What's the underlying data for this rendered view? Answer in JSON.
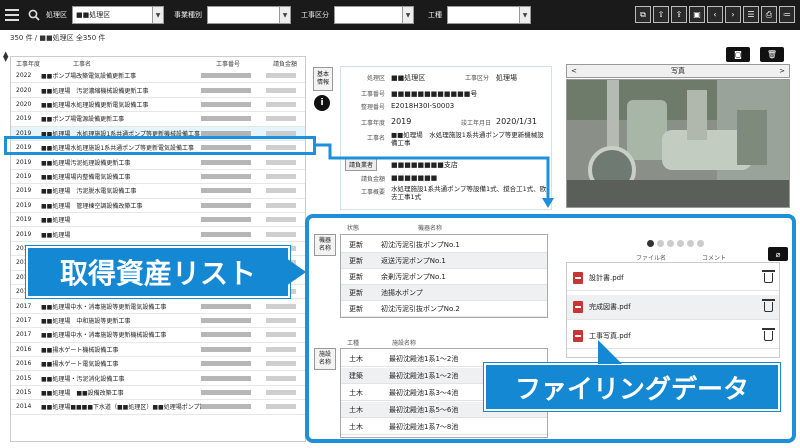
{
  "topbar": {
    "filter_label_1": "処理区",
    "filter_value_1": "■■処理区",
    "filter_label_2": "事業種別",
    "filter_label_3": "工事区分",
    "filter_label_4": "工種"
  },
  "breadcrumb": "350 件 / ■■処理区 全350 件",
  "list": {
    "headers": [
      "工事年度",
      "工事名",
      "工事番号",
      "請負金額"
    ],
    "rows": [
      {
        "year": "2022",
        "name": "■■ポンプ場改築電気設備更新工事"
      },
      {
        "year": "2020",
        "name": "■■処理場　汚泥濃縮機械設備更新工事"
      },
      {
        "year": "2020",
        "name": "■■処理場水処理設備更新電気設備工事"
      },
      {
        "year": "2019",
        "name": "■■ポンプ場電源設備更新工事"
      },
      {
        "year": "2019",
        "name": "■■処理場　水処理施設1系共通ポンプ等更新機械設備工事"
      },
      {
        "year": "2019",
        "name": "■■処理場水処理施設1系共通ポンプ等更新電気設備工事"
      },
      {
        "year": "2019",
        "name": "■■処理場汚泥処理設備更新工事"
      },
      {
        "year": "2019",
        "name": "■■処理場場内整備電気設備工事"
      },
      {
        "year": "2019",
        "name": "■■処理場　汚泥脱水電気設備工事"
      },
      {
        "year": "2019",
        "name": "■■処理場　管理棟空調設備改築工事"
      },
      {
        "year": "2019",
        "name": "■■処理場"
      },
      {
        "year": "2019",
        "name": "■■処理場"
      },
      {
        "year": "2019",
        "name": "■■処理場"
      },
      {
        "year": "2018",
        "name": "■■処理場"
      },
      {
        "year": "2018",
        "name": "■■処理場"
      },
      {
        "year": "2017",
        "name": "■■処理場■■下水道（■■処理区）"
      },
      {
        "year": "2017",
        "name": "■■処理場中水・消毒施設等更新電気設備工事"
      },
      {
        "year": "2017",
        "name": "■■処理場　中和施設等更新工事"
      },
      {
        "year": "2017",
        "name": "■■処理場中水・消毒施設等更新機械設備工事"
      },
      {
        "year": "2016",
        "name": "■■揚水ゲート機械設備工事"
      },
      {
        "year": "2016",
        "name": "■■揚水ゲート電気設備工事"
      },
      {
        "year": "2015",
        "name": "■■処理場・汚泥消化設備工事"
      },
      {
        "year": "2015",
        "name": "■■処理場　■■設備改築工事"
      },
      {
        "year": "2014",
        "name": "■■処理場■■■■下水道（■■処理区）■■処理場ポンプ設備工事"
      }
    ]
  },
  "side": {
    "basic_info": "基本\n情報",
    "info_icon": "i",
    "equipment_label": "機器\n名称",
    "construction_label": "施設\n名称"
  },
  "detail": {
    "label_area": "処理区",
    "value_area": "■■処理区",
    "label_kubun": "工事区分",
    "value_kubun": "処理場",
    "label_no": "工事番号",
    "value_no": "■■■■■■■■■■■■号",
    "label_seiri": "整理番号",
    "value_seiri": "E2018H30I-S0003",
    "label_year": "工事年度",
    "value_year": "2019",
    "label_end": "竣工年月日",
    "value_end": "2020/1/31",
    "label_name": "工事名",
    "value_name": "■■処理場　水処理施設1系共通ポンプ等更新機械設備工事",
    "contractor_btn": "請負業者",
    "value_contractor": "■■■■■■■■支店",
    "label_amount": "請負金額",
    "value_amount": "■■■■■■■",
    "label_summary": "工事概要",
    "value_summary": "水処理施設1系共通ポンプ等設備1式、撹合工1式、欧去工事1式"
  },
  "equipment": {
    "col_status": "状態",
    "col_name": "機器名称",
    "rows": [
      {
        "status": "更新",
        "name": "初沈汚泥引抜ポンプNo.1"
      },
      {
        "status": "更新",
        "name": "返送汚泥ポンプNo.1"
      },
      {
        "status": "更新",
        "name": "余剰汚泥ポンプNo.1"
      },
      {
        "status": "更新",
        "name": "池揚水ポンプ"
      },
      {
        "status": "更新",
        "name": "初沈汚泥引抜ポンプNo.2"
      }
    ]
  },
  "construction": {
    "col_type": "工種",
    "col_name": "施設名称",
    "rows": [
      {
        "type": "土木",
        "name": "最初沈殿池1系1〜2池"
      },
      {
        "type": "建築",
        "name": "最初沈殿池1系1〜2池"
      },
      {
        "type": "土木",
        "name": "最初沈殿池1系3〜4池"
      },
      {
        "type": "土木",
        "name": "最初沈殿池1系5〜6池"
      },
      {
        "type": "土木",
        "name": "最初沈殿池1系7〜8池"
      }
    ]
  },
  "photo": {
    "title": "写真",
    "prev": "<",
    "next": ">"
  },
  "files": {
    "col_file": "ファイル名",
    "col_comment": "コメント",
    "rows": [
      {
        "name": "設計書.pdf"
      },
      {
        "name": "完成図書.pdf"
      },
      {
        "name": "工事写真.pdf"
      }
    ]
  },
  "callouts": {
    "asset_list": "取得資産リスト",
    "filing_data": "ファイリングデータ"
  },
  "colors": {
    "accent": "#1e90d9",
    "topbar": "#1a1a1a"
  }
}
